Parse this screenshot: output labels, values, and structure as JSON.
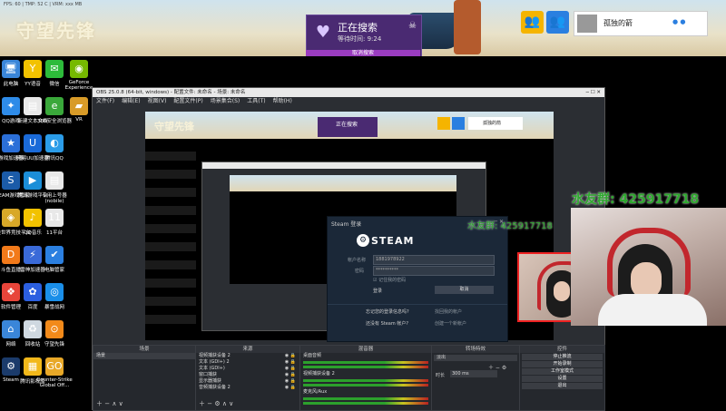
{
  "perf_overlay": "FPS: 60  |  TMP: 52 C  |  VRM: xxx MB",
  "banner": {
    "logo": "守望先锋",
    "search": {
      "title": "正在搜索",
      "wait": "等待时间: 9:24",
      "cancel": "取消搜索"
    },
    "player": {
      "name": "孤独的箭",
      "icons": "● ●"
    }
  },
  "desktop_icons": [
    {
      "label": "此电脑",
      "icon": "computer-icon",
      "color": "#3a86d9",
      "glyph": "🖥"
    },
    {
      "label": "YY语音",
      "icon": "yy-icon",
      "color": "#f2c200",
      "glyph": "Y"
    },
    {
      "label": "微信",
      "icon": "wechat-icon",
      "color": "#2dbb3a",
      "glyph": "✉"
    },
    {
      "label": "GeForce Experience",
      "icon": "nvidia-icon",
      "color": "#76b900",
      "glyph": "◉"
    },
    {
      "label": "QQ游戏",
      "icon": "qqgame-icon",
      "color": "#2e8be8",
      "glyph": "✦"
    },
    {
      "label": "新建文本文档",
      "icon": "textdoc-icon",
      "color": "#e8e8e8",
      "glyph": "▤"
    },
    {
      "label": "360安全浏览器",
      "icon": "360-browser-icon",
      "color": "#3aa83a",
      "glyph": "e"
    },
    {
      "label": "VR",
      "icon": "folder-icon",
      "color": "#d89b28",
      "glyph": "▰"
    },
    {
      "label": "游戏加速器",
      "icon": "accelerator-icon",
      "color": "#2b6fd8",
      "glyph": "★"
    },
    {
      "label": "网易UU加速器",
      "icon": "uu-icon",
      "color": "#1a6ad8",
      "glyph": "U"
    },
    {
      "label": "腾讯QQ",
      "icon": "qq-icon",
      "color": "#2b9ce8",
      "glyph": "◐"
    },
    {
      "label": "STEAM游戏管家",
      "icon": "steam-manager-icon",
      "color": "#1b5ba8",
      "glyph": "S"
    },
    {
      "label": "腾讯游戏平台",
      "icon": "tgp-icon",
      "color": "#1b8ed8",
      "glyph": "▶"
    },
    {
      "label": "专用上号器(nobile)",
      "icon": "login-tool-icon",
      "color": "#e8e8e8",
      "glyph": "▤"
    },
    {
      "label": "完美世界竞技平台",
      "icon": "perfect-icon",
      "color": "#d8a828",
      "glyph": "◈"
    },
    {
      "label": "QQ音乐",
      "icon": "qqmusic-icon",
      "color": "#f2c200",
      "glyph": "♪"
    },
    {
      "label": "11平台",
      "icon": "11-platform-icon",
      "color": "#e8e8e8",
      "glyph": "11"
    },
    {
      "label": "斗鱼直播",
      "icon": "douyu-icon",
      "color": "#f27a1a",
      "glyph": "D"
    },
    {
      "label": "雷神加速器",
      "icon": "leishen-icon",
      "color": "#3a6ad8",
      "glyph": "⚡"
    },
    {
      "label": "电脑管家",
      "icon": "pcmanager-icon",
      "color": "#2b7fe0",
      "glyph": "✔"
    },
    {
      "label": "软件管理",
      "icon": "software-icon",
      "color": "#e8453a",
      "glyph": "❖"
    },
    {
      "label": "百度",
      "icon": "baidu-icon",
      "color": "#2b5fe0",
      "glyph": "✿"
    },
    {
      "label": "暴雪战网",
      "icon": "battlenet-icon",
      "color": "#1a8ee8",
      "glyph": "◎"
    },
    {
      "label": "网络",
      "icon": "network-icon",
      "color": "#3a86d9",
      "glyph": "⌂"
    },
    {
      "label": "回收站",
      "icon": "recycle-bin-icon",
      "color": "#cfd8e0",
      "glyph": "♻"
    },
    {
      "label": "守望先锋",
      "icon": "overwatch-icon",
      "color": "#f28a1a",
      "glyph": "⊙"
    },
    {
      "label": "Steam",
      "icon": "steam-icon",
      "color": "#1b3b6b",
      "glyph": "⚙"
    },
    {
      "label": "腾讯影视库",
      "icon": "tencent-video-icon",
      "color": "#f2b81a",
      "glyph": "▦"
    },
    {
      "label": "Counter-Strike Global Off...",
      "icon": "csgo-icon",
      "color": "#e8a828",
      "glyph": "GO"
    }
  ],
  "obs": {
    "title": "OBS 25.0.8 (64-bit, windows) - 配置文件: 未命名 - 场景: 未命名",
    "menu": [
      "文件(F)",
      "编辑(E)",
      "视图(V)",
      "配置文件(P)",
      "场景集合(S)",
      "工具(T)",
      "帮助(H)"
    ],
    "docks": {
      "scenes": {
        "header": "场景",
        "items": [
          "场景"
        ]
      },
      "sources": {
        "header": "来源",
        "items": [
          "视频捕获设备 2",
          "文本 (GDI+) 2",
          "文本 (GDI+)",
          "窗口捕获",
          "显示器捕获",
          "音频捕获设备 2"
        ]
      },
      "mixer": {
        "header": "混音器",
        "items": [
          "桌面音频",
          "视频捕获设备 2",
          "麦克风/Aux"
        ]
      },
      "transitions": {
        "header": "转场特效",
        "type": "淡出",
        "duration_label": "时长",
        "duration": "300 ms"
      },
      "controls": {
        "header": "控件",
        "buttons": [
          "停止推流",
          "开始录制",
          "工作室模式",
          "设置",
          "退出"
        ]
      }
    },
    "steam_dialog": {
      "title": "Steam 登录",
      "logo": "STEAM",
      "account_label": "帐户名称",
      "account_value": "1881978922",
      "password_label": "密码",
      "password_value": "**********",
      "remember": "记住我的密码",
      "login": "登录",
      "cancel": "取消",
      "help": "忘记您的登录信息吗?",
      "recover": "找回我的帐户",
      "no_account": "还没有 Steam 帐户?",
      "create": "创建一个新帐户"
    }
  },
  "overlay": {
    "fan_group": "水友群:  425917718",
    "fan_group_inner": "水友群:  425917718"
  }
}
